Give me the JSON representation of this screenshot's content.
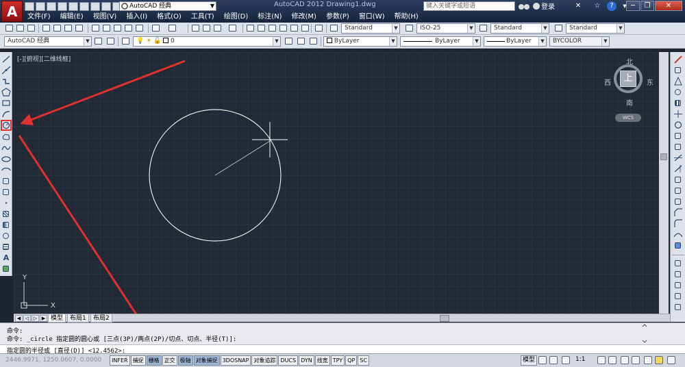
{
  "app": {
    "title": "AutoCAD 2012  Drawing1.dwg",
    "workspace": "AutoCAD 经典",
    "search_placeholder": "键入关键字或短语",
    "login_label": "登录"
  },
  "menu": [
    "文件(F)",
    "编辑(E)",
    "视图(V)",
    "插入(I)",
    "格式(O)",
    "工具(T)",
    "绘图(D)",
    "标注(N)",
    "修改(M)",
    "参数(P)",
    "窗口(W)",
    "帮助(H)"
  ],
  "toolbar1": {
    "text_style": "Standard",
    "dim_style": "ISO-25",
    "table_style": "Standard",
    "multileader_style": "Standard"
  },
  "toolbar2": {
    "workspace": "AutoCAD 经典",
    "layer": "0",
    "color": "ByLayer",
    "linetype": "ByLayer",
    "lineweight": "ByLayer",
    "plotstyle": "BYCOLOR"
  },
  "viewport": {
    "label": "[-][俯视][二维线框]",
    "viewcube": {
      "north": "北",
      "south": "南",
      "east": "东",
      "west": "西",
      "face": "上",
      "wcs": "WCS"
    },
    "ucs": {
      "x": "X",
      "y": "Y"
    }
  },
  "layout_tabs": [
    "模型",
    "布局1",
    "布局2"
  ],
  "command": {
    "line1": "命令:",
    "line2": "命令: _circle 指定圆的圆心或 [三点(3P)/两点(2P)/切点、切点、半径(T)]:",
    "prompt": "指定圆的半径或 [直径(D)] <12.4562>:"
  },
  "status": {
    "coords": "2446.9971, 1250.0607, 0.0000",
    "toggles": [
      {
        "label": "INFER",
        "on": false
      },
      {
        "label": "捕捉",
        "on": false
      },
      {
        "label": "栅格",
        "on": true
      },
      {
        "label": "正交",
        "on": false
      },
      {
        "label": "极轴",
        "on": true
      },
      {
        "label": "对象捕捉",
        "on": true
      },
      {
        "label": "3DOSNAP",
        "on": false
      },
      {
        "label": "对象追踪",
        "on": false
      },
      {
        "label": "DUCS",
        "on": false
      },
      {
        "label": "DYN",
        "on": false
      },
      {
        "label": "线宽",
        "on": false
      },
      {
        "label": "TPY",
        "on": false
      },
      {
        "label": "QP",
        "on": false
      },
      {
        "label": "SC",
        "on": false
      }
    ],
    "model": "模型",
    "scale": "1:1"
  },
  "colors": {
    "canvas": "#222a36",
    "annotation_arrow": "#e03030",
    "circle_stroke": "#e8e8e8",
    "toggle_on": "#9eb6d6"
  }
}
